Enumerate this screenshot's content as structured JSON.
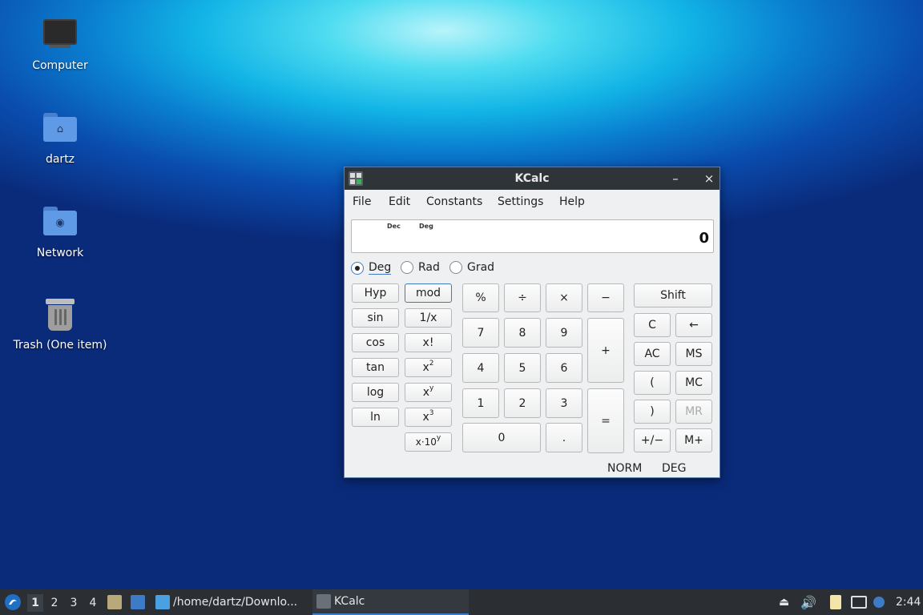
{
  "desktop": {
    "icons": [
      {
        "label": "Computer"
      },
      {
        "label": "dartz"
      },
      {
        "label": "Network"
      },
      {
        "label": "Trash (One item)"
      }
    ]
  },
  "window": {
    "title": "KCalc",
    "minimize": "–",
    "close": "×",
    "menu": [
      "File",
      "Edit",
      "Constants",
      "Settings",
      "Help"
    ],
    "display": {
      "base_indicator": "Dec",
      "angle_indicator": "Deg",
      "value": "0"
    },
    "angle_modes": [
      {
        "label": "Deg",
        "selected": true
      },
      {
        "label": "Rad",
        "selected": false
      },
      {
        "label": "Grad",
        "selected": false
      }
    ],
    "buttons": {
      "hyp": "Hyp",
      "mod": "mod",
      "sin": "sin",
      "inv": "1/x",
      "cos": "cos",
      "fact": "x!",
      "tan": "tan",
      "sq_base": "x",
      "sq_exp": "2",
      "log": "log",
      "pow_base": "x",
      "pow_exp": "y",
      "ln": "ln",
      "cube_base": "x",
      "cube_exp": "3",
      "sci_base": "x·10",
      "sci_exp": "y",
      "percent": "%",
      "divide": "÷",
      "multiply": "×",
      "minus": "−",
      "n7": "7",
      "n8": "8",
      "n9": "9",
      "plus": "+",
      "n4": "4",
      "n5": "5",
      "n6": "6",
      "n1": "1",
      "n2": "2",
      "n3": "3",
      "equals": "=",
      "n0": "0",
      "dot": ".",
      "shift": "Shift",
      "clear": "C",
      "backspace": "←",
      "all_clear": "AC",
      "ms": "MS",
      "lparen": "(",
      "mc": "MC",
      "rparen": ")",
      "mr": "MR",
      "sign": "+/−",
      "mplus": "M+"
    },
    "status": {
      "notation": "NORM",
      "angle": "DEG"
    }
  },
  "taskbar": {
    "workspaces": [
      "1",
      "2",
      "3",
      "4"
    ],
    "current_workspace": "1",
    "tasks": [
      {
        "label": "/home/dartz/Downlo..."
      },
      {
        "label": "KCalc"
      }
    ],
    "clock": "2:44"
  },
  "colors": {
    "accent": "#3d7bc6",
    "titlebar": "#2f3439",
    "taskbar": "#2b2f34"
  }
}
